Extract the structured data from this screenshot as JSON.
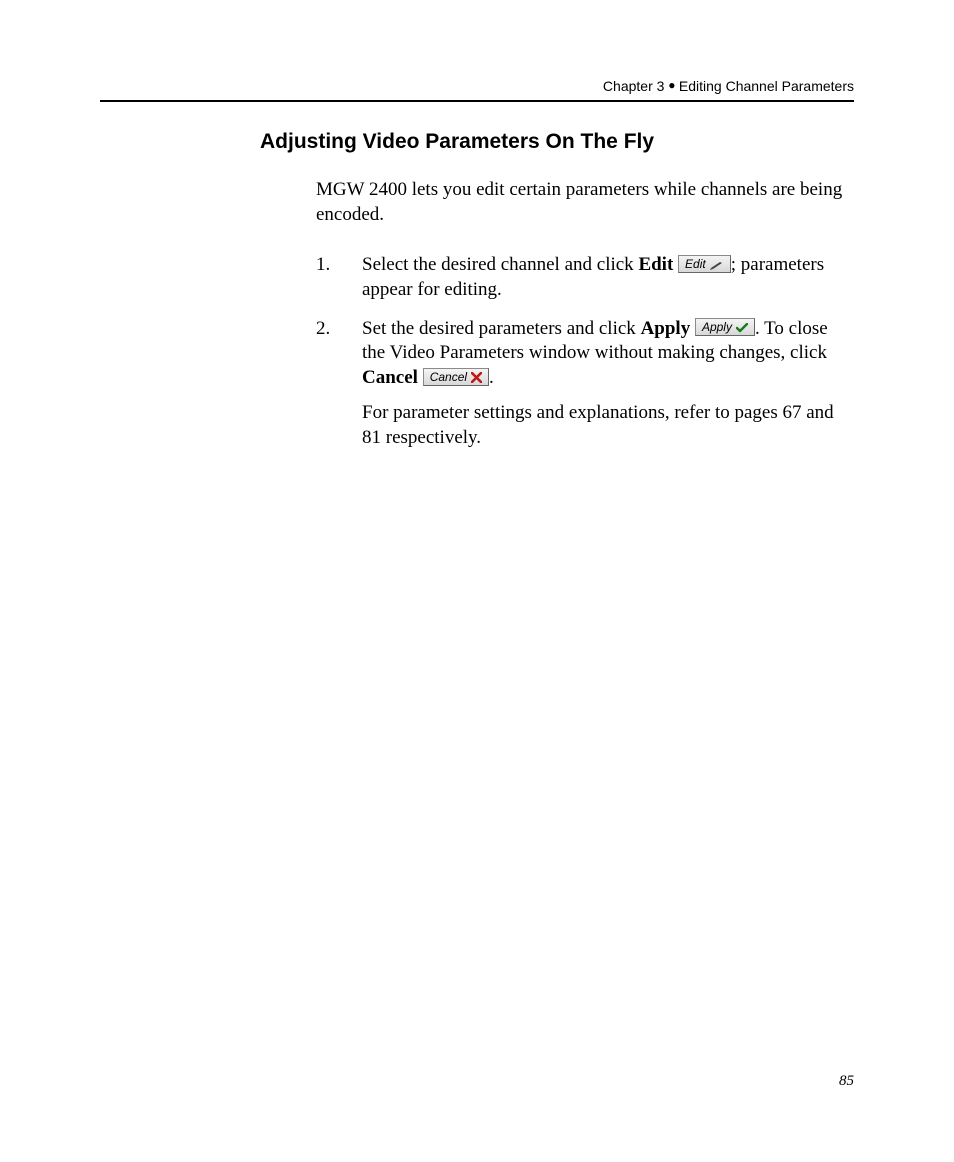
{
  "header": {
    "chapter_label": "Chapter 3",
    "chapter_title": "Editing Channel Parameters"
  },
  "section_title": "Adjusting Video Parameters On The Fly",
  "intro": "MGW 2400 lets you edit certain parameters while channels are being encoded.",
  "steps": {
    "s1": {
      "pre": "Select the desired channel and click ",
      "bold1": "Edit",
      "button_label": "Edit",
      "post": "; parameters appear for editing."
    },
    "s2": {
      "pre": "Set the desired parameters and click ",
      "bold1": "Apply",
      "apply_button_label": "Apply",
      "mid": ". To close the Video Parameters window without making changes, click ",
      "bold2": "Cancel",
      "cancel_button_label": "Cancel",
      "post": ".",
      "follow": "For parameter settings and explanations, refer to pages 67 and 81 respectively."
    }
  },
  "page_number": "85"
}
